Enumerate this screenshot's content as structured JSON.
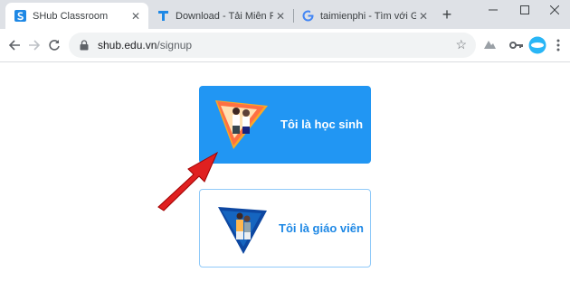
{
  "browser": {
    "tabs": [
      {
        "title": "SHub Classroom",
        "favicon": "shub-icon",
        "active": true
      },
      {
        "title": "Download - Tải Miễn Phí VN - P",
        "favicon": "taimienphi-icon",
        "active": false
      },
      {
        "title": "taimienphi - Tìm với Google",
        "favicon": "google-icon",
        "active": false
      }
    ],
    "new_tab": "+",
    "address": {
      "host": "shub.edu.vn",
      "path": "/signup"
    }
  },
  "signup": {
    "student_label": "Tôi là học sinh",
    "teacher_label": "Tôi là giáo viên"
  },
  "colors": {
    "accent": "#2196f3",
    "annotation_arrow": "#e02020"
  }
}
